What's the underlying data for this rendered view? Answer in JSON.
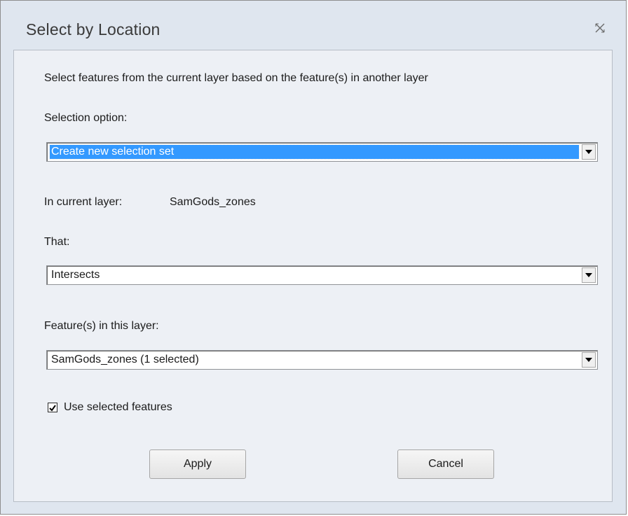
{
  "window": {
    "title": "Select by Location"
  },
  "dialog": {
    "description": "Select features from the current layer based on the feature(s) in another layer",
    "selection_option": {
      "label": "Selection option:",
      "value": "Create new selection set"
    },
    "current_layer": {
      "label": "In current layer:",
      "value": "SamGods_zones"
    },
    "relationship": {
      "label": "That:",
      "value": "Intersects"
    },
    "feature_layer": {
      "label": "Feature(s) in this layer:",
      "value": "SamGods_zones (1 selected)"
    },
    "use_selected": {
      "label": "Use selected features",
      "checked": true
    },
    "buttons": {
      "apply": "Apply",
      "cancel": "Cancel"
    }
  },
  "icons": {
    "close": "close-icon",
    "dropdown": "chevron-down-icon",
    "check": "check-icon"
  },
  "colors": {
    "selection_highlight": "#3399ff",
    "window_frame": "#dfe6ef",
    "client_background": "#edf0f5"
  }
}
